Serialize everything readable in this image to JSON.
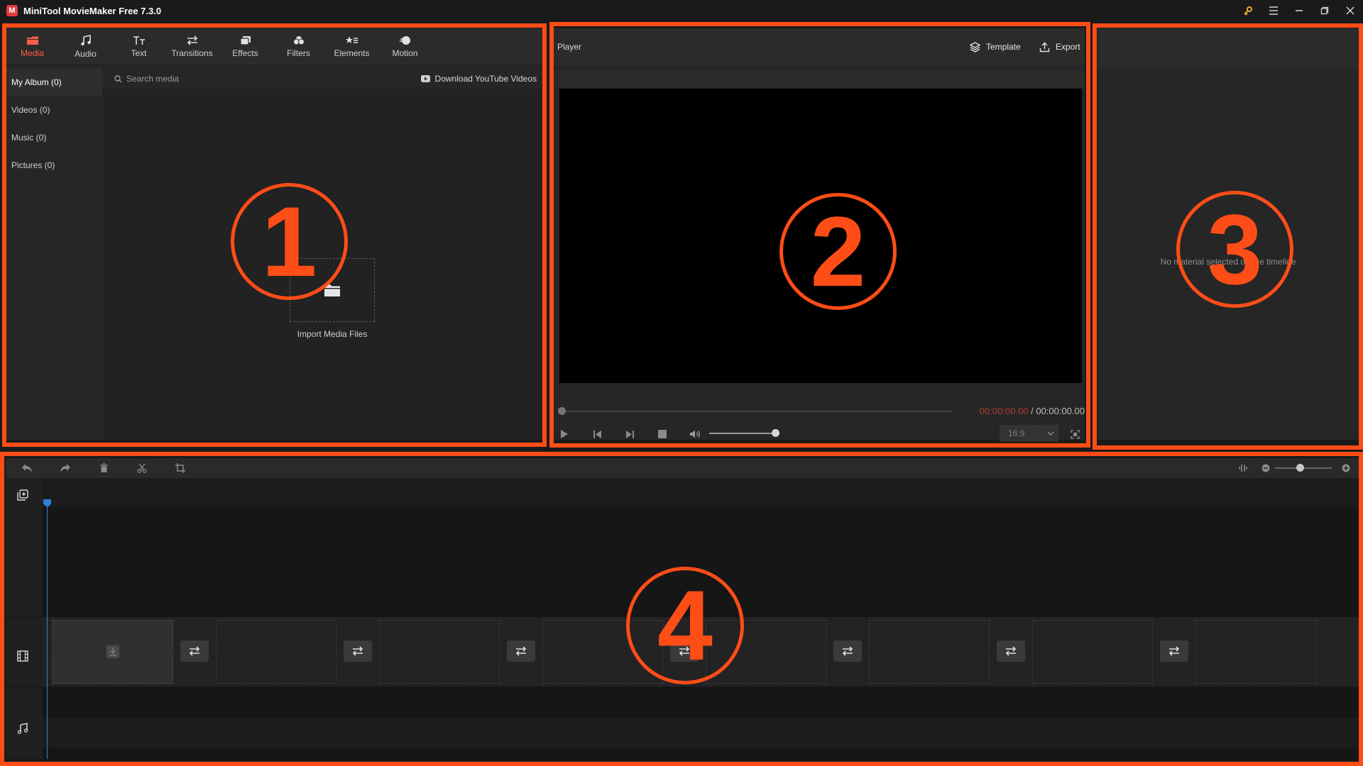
{
  "app": {
    "title": "MiniTool MovieMaker Free 7.3.0",
    "logo_letter": "M",
    "accent": "#ff5c4a"
  },
  "window_controls": [
    "key-icon",
    "menu-icon",
    "minimize-icon",
    "maximize-icon",
    "close-icon"
  ],
  "media_tabs": [
    {
      "label": "Media",
      "icon": "media-icon",
      "active": true
    },
    {
      "label": "Audio",
      "icon": "music-note-icon"
    },
    {
      "label": "Text",
      "icon": "text-icon"
    },
    {
      "label": "Transitions",
      "icon": "transitions-icon"
    },
    {
      "label": "Effects",
      "icon": "effects-icon"
    },
    {
      "label": "Filters",
      "icon": "filters-icon"
    },
    {
      "label": "Elements",
      "icon": "elements-icon"
    },
    {
      "label": "Motion",
      "icon": "motion-icon"
    }
  ],
  "album": {
    "items": [
      {
        "label": "My Album (0)",
        "active": true
      },
      {
        "label": "Videos (0)"
      },
      {
        "label": "Music (0)"
      },
      {
        "label": "Pictures (0)"
      }
    ]
  },
  "search": {
    "placeholder": "Search media"
  },
  "download_youtube": "Download YouTube Videos",
  "import_label": "Import Media Files",
  "player": {
    "title": "Player",
    "template_label": "Template",
    "export_label": "Export",
    "time_current": "00:00:00.00",
    "time_separator": " / ",
    "time_total": "00:00:00.00",
    "aspect_ratio": "16:9",
    "volume_level": 0.82
  },
  "properties": {
    "empty_text": "No material selected on the timeline"
  },
  "timeline": {
    "zoom_level": 0.5,
    "tools": [
      "undo-icon",
      "redo-icon",
      "delete-icon",
      "split-icon",
      "crop-icon"
    ],
    "clip_slots": 8
  },
  "annotations": {
    "color": "#ff4d17",
    "labels": [
      "1",
      "2",
      "3",
      "4"
    ]
  }
}
